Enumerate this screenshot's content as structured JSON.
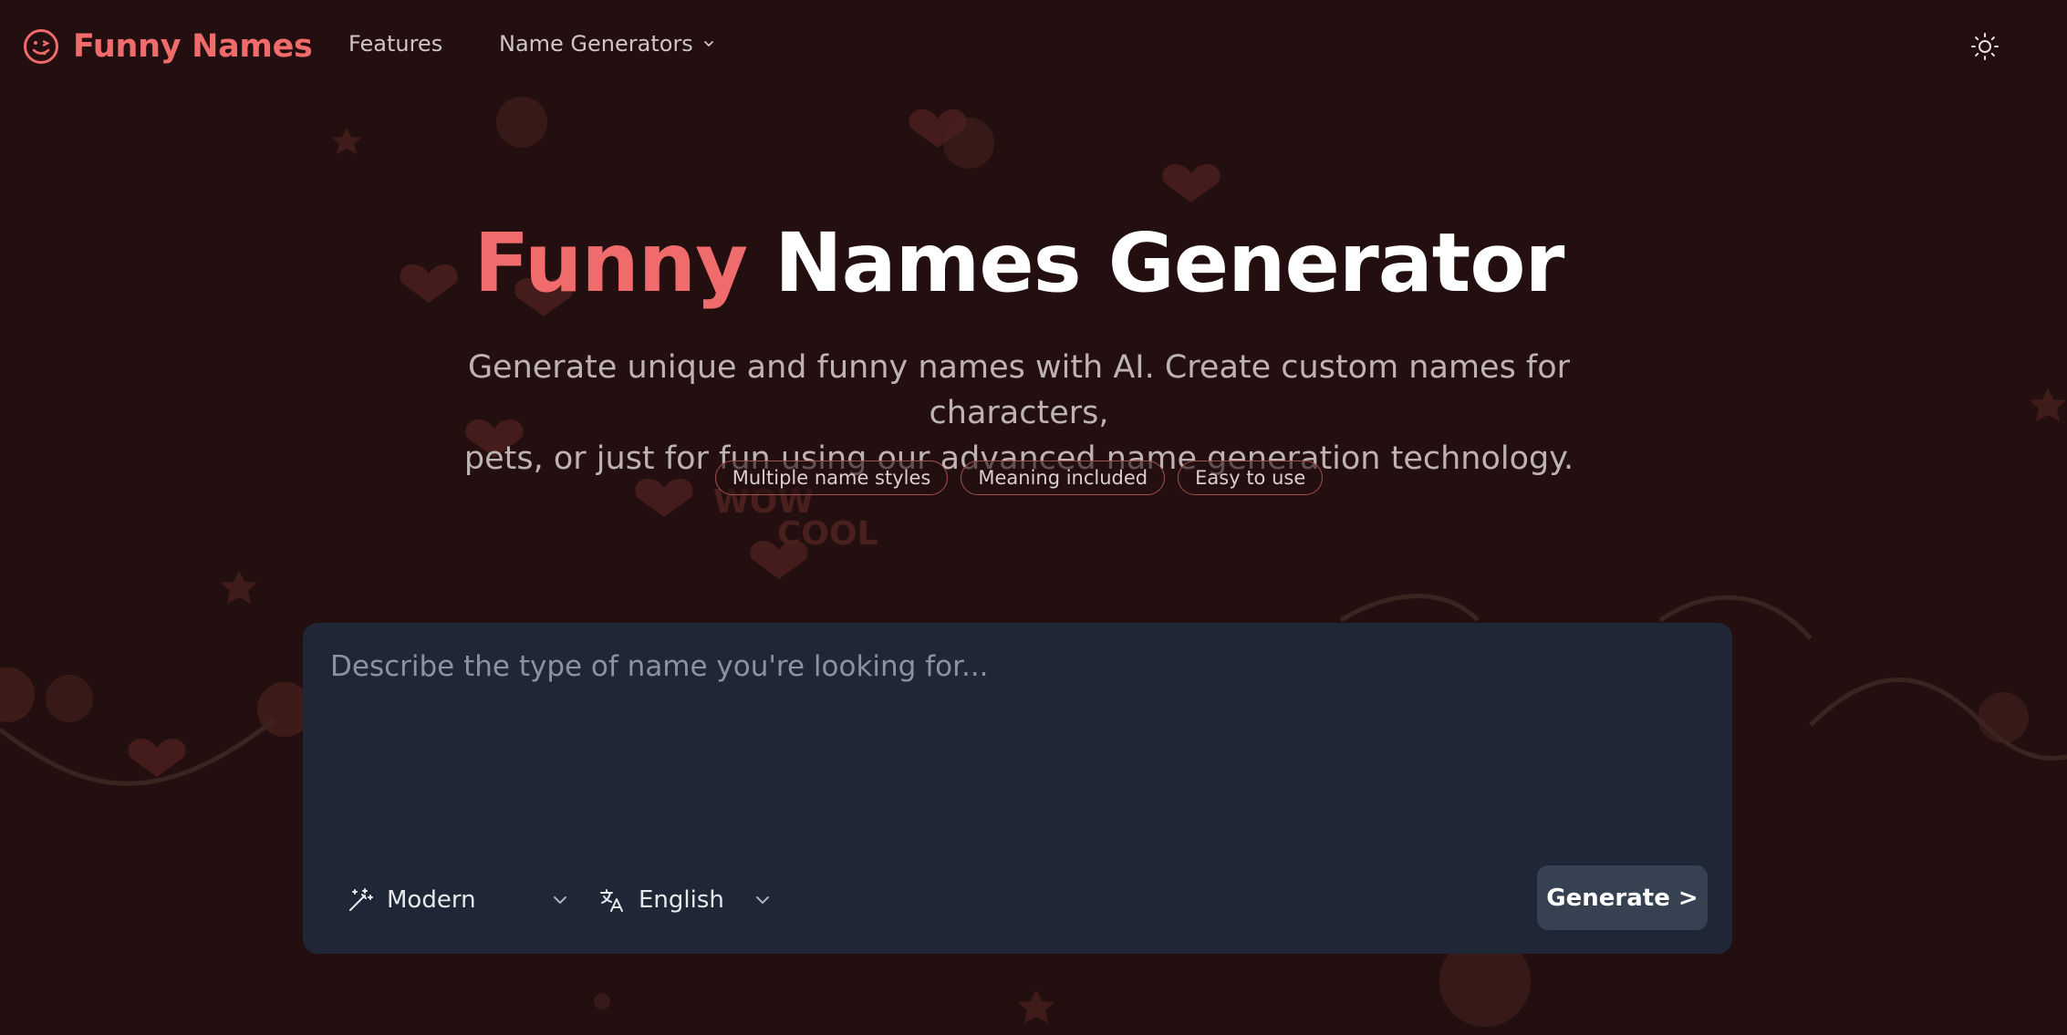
{
  "header": {
    "brand_name": "Funny Names",
    "nav": {
      "features_label": "Features",
      "generators_label": "Name Generators"
    }
  },
  "hero": {
    "title_accent": "Funny",
    "title_rest": "Names Generator",
    "subtitle_line1": "Generate unique and funny names with AI. Create custom names for characters,",
    "subtitle_line2": "pets, or just for fun using our advanced name generation technology.",
    "tags": [
      "Multiple name styles",
      "Meaning included",
      "Easy to use"
    ]
  },
  "decor": {
    "words": [
      "WOW",
      "COOL"
    ]
  },
  "generator": {
    "prompt_placeholder": "Describe the type of name you're looking for...",
    "prompt_value": "",
    "style_value": "Modern",
    "language_value": "English",
    "generate_label": "Generate >"
  },
  "colors": {
    "background": "#230f0f",
    "accent": "#f06b6b",
    "card": "#1f2736",
    "button": "#364152"
  },
  "icons": {
    "logo": "smiley-icon",
    "theme": "sun-icon",
    "style": "magic-wand-icon",
    "language": "translate-icon",
    "dropdown": "chevron-down-icon"
  }
}
